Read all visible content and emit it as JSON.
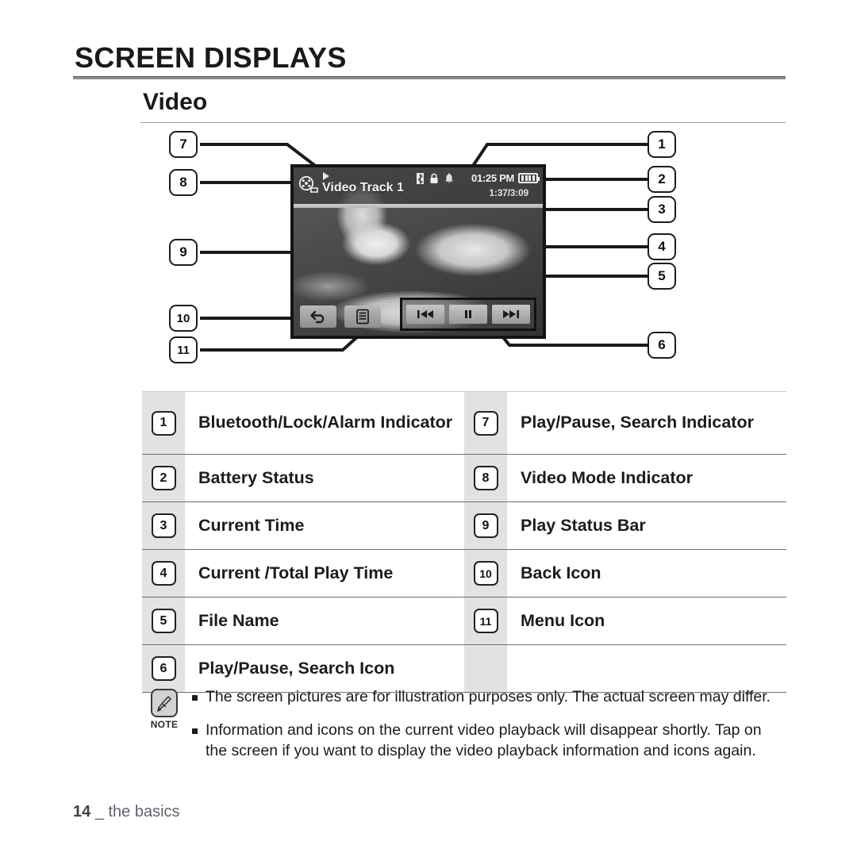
{
  "header": {
    "chapter_title": "SCREEN DISPLAYS",
    "section_title": "Video"
  },
  "device_screen": {
    "mode_icon": "film-reel-icon",
    "play_indicator_icon": "play-triangle-icon",
    "file_name": "Video Track 1",
    "status_icons": [
      "bluetooth-icon",
      "lock-icon",
      "alarm-icon"
    ],
    "current_time": "01:25 PM",
    "battery_icon": "battery-full-icon",
    "play_time": "1:37/3:09",
    "back_icon": "back-arrow-icon",
    "menu_icon": "menu-list-icon",
    "transport": {
      "previous_icon": "skip-previous-icon",
      "pause_icon": "pause-icon",
      "next_icon": "skip-next-icon"
    }
  },
  "callouts": {
    "left": [
      "7",
      "8",
      "9",
      "10",
      "11"
    ],
    "right": [
      "1",
      "2",
      "3",
      "4",
      "5",
      "6"
    ]
  },
  "legend": {
    "rows": [
      {
        "left_num": "1",
        "left_label": "Bluetooth/Lock/Alarm Indicator",
        "right_num": "7",
        "right_label": "Play/Pause, Search Indicator"
      },
      {
        "left_num": "2",
        "left_label": "Battery Status",
        "right_num": "8",
        "right_label": "Video Mode Indicator"
      },
      {
        "left_num": "3",
        "left_label": "Current Time",
        "right_num": "9",
        "right_label": "Play Status Bar"
      },
      {
        "left_num": "4",
        "left_label": "Current /Total Play Time",
        "right_num": "10",
        "right_label": "Back Icon"
      },
      {
        "left_num": "5",
        "left_label": "File Name",
        "right_num": "11",
        "right_label": "Menu Icon"
      },
      {
        "left_num": "6",
        "left_label": "Play/Pause, Search Icon",
        "right_num": "",
        "right_label": ""
      }
    ]
  },
  "note": {
    "label": "NOTE",
    "items": [
      "The screen pictures are for illustration purposes only. The actual screen may differ.",
      "Information and icons on the current video playback will disappear shortly. Tap on the screen if you want to display the video playback information and icons again."
    ]
  },
  "footer": {
    "page_number": "14",
    "separator": "_",
    "section": "the basics"
  }
}
